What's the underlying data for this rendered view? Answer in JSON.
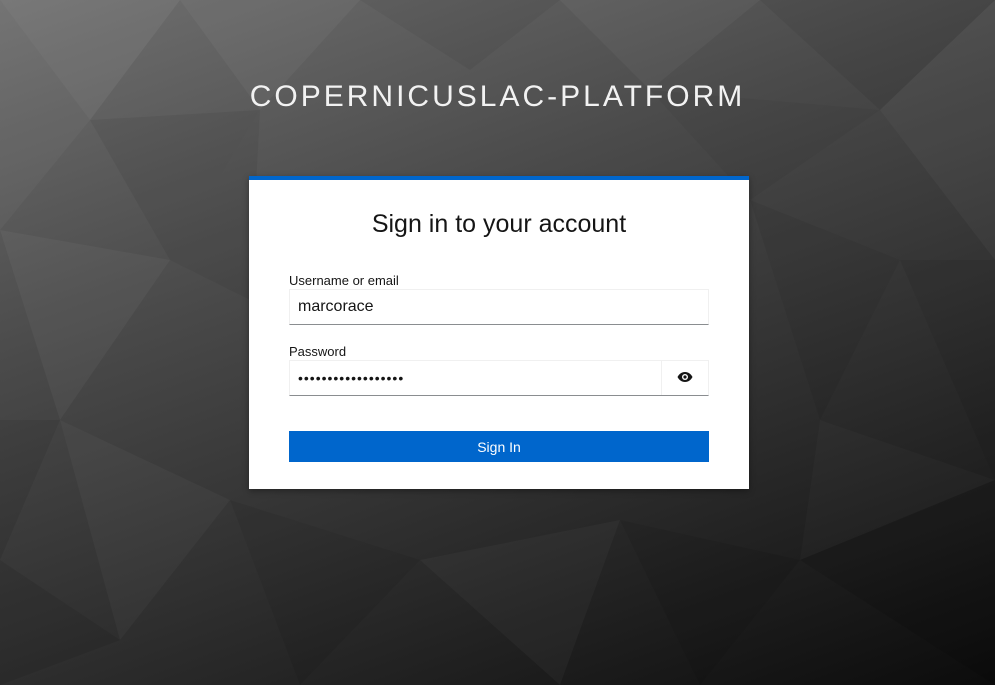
{
  "realm": {
    "title": "COPERNICUSLAC-PLATFORM"
  },
  "login": {
    "heading": "Sign in to your account",
    "username_label": "Username or email",
    "username_value": "marcorace",
    "password_label": "Password",
    "password_value": "••••••••••••••••••",
    "show_password_icon": "eye-icon",
    "submit_label": "Sign In"
  },
  "colors": {
    "accent": "#0066cc",
    "card_background": "#ffffff"
  }
}
